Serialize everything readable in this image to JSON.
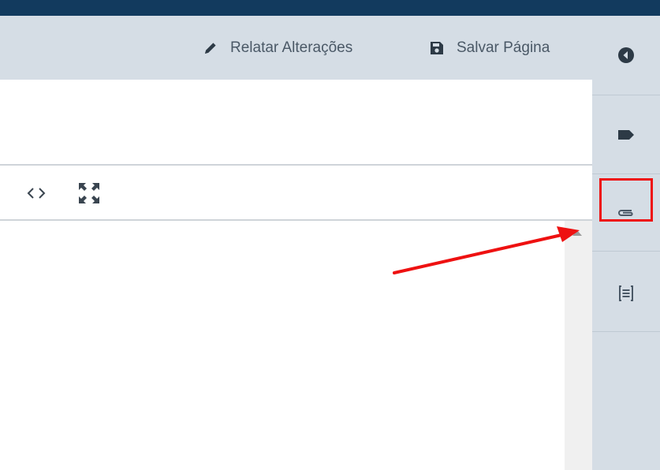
{
  "header": {
    "report_changes_label": "Relatar Alterações",
    "save_page_label": "Salvar Página",
    "report_icon": "pencil-icon",
    "save_icon": "floppy-disk-icon"
  },
  "toolbar": {
    "code_icon": "code-view-icon",
    "fullscreen_icon": "expand-fullscreen-icon"
  },
  "rightbar": {
    "items": [
      {
        "icon": "collapse-left-icon"
      },
      {
        "icon": "tag-icon"
      },
      {
        "icon": "paperclip-icon"
      },
      {
        "icon": "document-scan-icon"
      }
    ]
  },
  "annotation": {
    "highlight_color": "#ee1111",
    "arrow_color": "#ee1111"
  },
  "colors": {
    "top_bar": "#123a5e",
    "header_bg": "#d5dde5",
    "text": "#4a5866"
  }
}
